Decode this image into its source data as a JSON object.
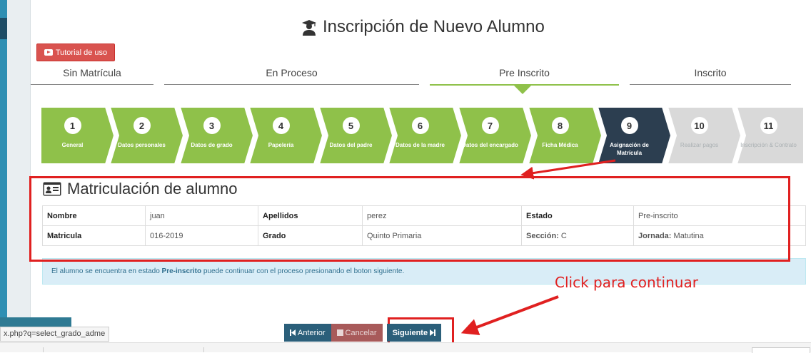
{
  "page": {
    "title": "Inscripción de Nuevo Alumno",
    "title_icon": "graduate-icon"
  },
  "tutorial_button": {
    "label": "Tutorial de uso",
    "icon": "youtube-icon"
  },
  "status_tabs": [
    {
      "label": "Sin Matrícula",
      "active": false
    },
    {
      "label": "En Proceso",
      "active": false
    },
    {
      "label": "Pre Inscrito",
      "active": true
    },
    {
      "label": "Inscrito",
      "active": false
    }
  ],
  "steps": [
    {
      "num": "1",
      "label": "General",
      "state": "done"
    },
    {
      "num": "2",
      "label": "Datos personales",
      "state": "done"
    },
    {
      "num": "3",
      "label": "Datos de grado",
      "state": "done"
    },
    {
      "num": "4",
      "label": "Papelería",
      "state": "done"
    },
    {
      "num": "5",
      "label": "Datos del padre",
      "state": "done"
    },
    {
      "num": "6",
      "label": "Datos de la madre",
      "state": "done"
    },
    {
      "num": "7",
      "label": "Datos del encargado",
      "state": "done"
    },
    {
      "num": "8",
      "label": "Ficha Médica",
      "state": "done"
    },
    {
      "num": "9",
      "label": "Asignación de Matrícula",
      "state": "current"
    },
    {
      "num": "10",
      "label": "Realizar pagos",
      "state": "pending"
    },
    {
      "num": "11",
      "label": "Inscripción & Contrato",
      "state": "pending"
    }
  ],
  "section": {
    "title": "Matriculación de alumno",
    "icon": "id-card-icon"
  },
  "info": {
    "nombre_label": "Nombre",
    "nombre": "juan",
    "apellidos_label": "Apellidos",
    "apellidos": "perez",
    "estado_label": "Estado",
    "estado": "Pre-inscrito",
    "matricula_label": "Matricula",
    "matricula": "016-2019",
    "grado_label": "Grado",
    "grado": "Quinto Primaria",
    "seccion_label": "Sección:",
    "seccion": "C",
    "jornada_label": "Jornada:",
    "jornada": "Matutina"
  },
  "alert": {
    "prefix": "El alumno se encuentra en estado ",
    "status": "Pre-inscrito",
    "suffix": " puede continuar con el proceso presionando el boton siguiente."
  },
  "annotation": {
    "text": "Click para continuar"
  },
  "buttons": {
    "prev": "Anterior",
    "cancel": "Cancelar",
    "next": "Siguiente"
  },
  "url_tooltip": "x.php?q=select_grado_adme",
  "colors": {
    "done": "#8fc14a",
    "current": "#2c3e50",
    "pending": "#d9d9d9",
    "annotation": "#e02020"
  }
}
